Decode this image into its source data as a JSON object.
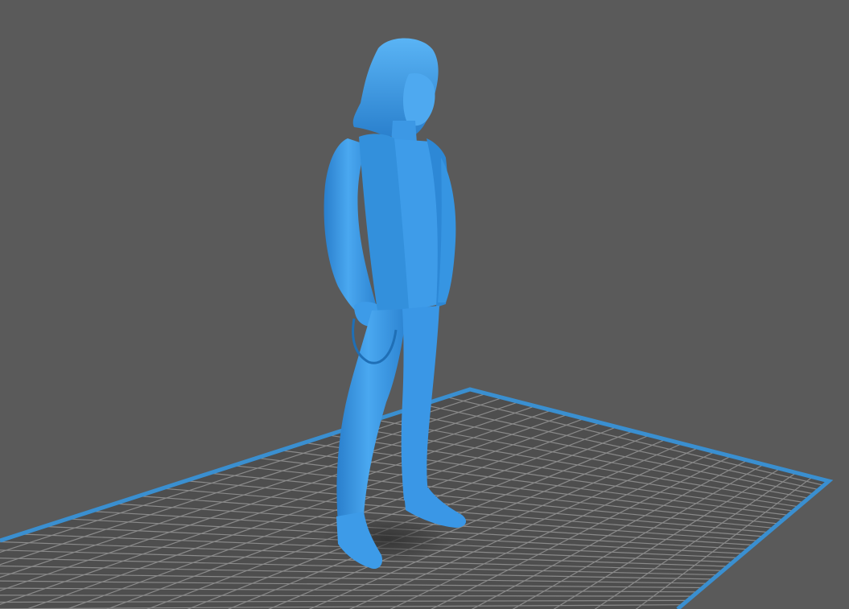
{
  "viewport": {
    "background_color": "#5a5a5a",
    "plate_fill_color": "#4e4e4e",
    "plate_border_color": "#3a8fd0",
    "grid_line_color": "#8a8a8a",
    "model_color": "#3d9be8",
    "model_highlight_color": "#6cc0ff",
    "model_shadow_color": "#1f6fb6"
  },
  "scene": {
    "object_type": "figurine",
    "grid_visible": true
  }
}
